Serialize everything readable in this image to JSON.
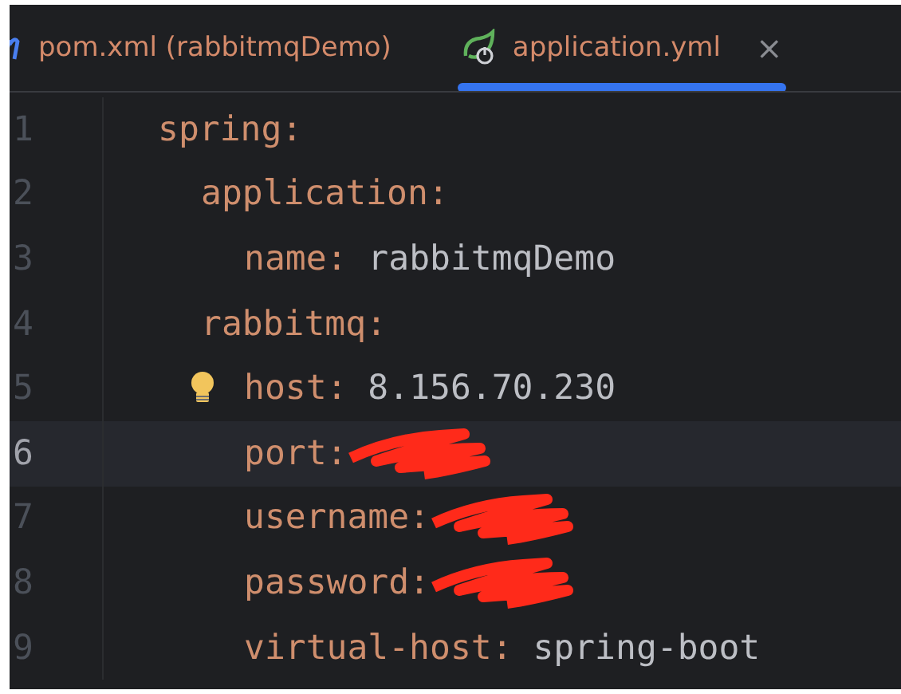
{
  "tabs": [
    {
      "kind": "maven",
      "label": "pom.xml (rabbitmqDemo)",
      "selected": false
    },
    {
      "kind": "spring",
      "label": "application.yml",
      "selected": true,
      "close": "×"
    }
  ],
  "editor": {
    "lines": [
      {
        "number": "1",
        "key": "spring:",
        "current": false,
        "children": [
          {
            "number": "2",
            "key": "application:",
            "current": false,
            "children": [
              {
                "number": "3",
                "key": "name:",
                "value": "rabbitmqDemo",
                "current": false
              }
            ]
          },
          {
            "number": "4",
            "key": "rabbitmq:",
            "current": false,
            "children": [
              {
                "number": "5",
                "key": "host:",
                "value": "8.156.70.230",
                "current": false,
                "bulb": true
              },
              {
                "number": "6",
                "key": "port:",
                "current": true,
                "redacted": true
              },
              {
                "number": "7",
                "key": "username:",
                "current": false,
                "redacted": true
              },
              {
                "number": "8",
                "key": "password:",
                "current": false,
                "redacted": true
              },
              {
                "number": "9",
                "key": "virtual-host:",
                "value": "spring-boot",
                "current": false
              }
            ]
          }
        ]
      }
    ]
  }
}
